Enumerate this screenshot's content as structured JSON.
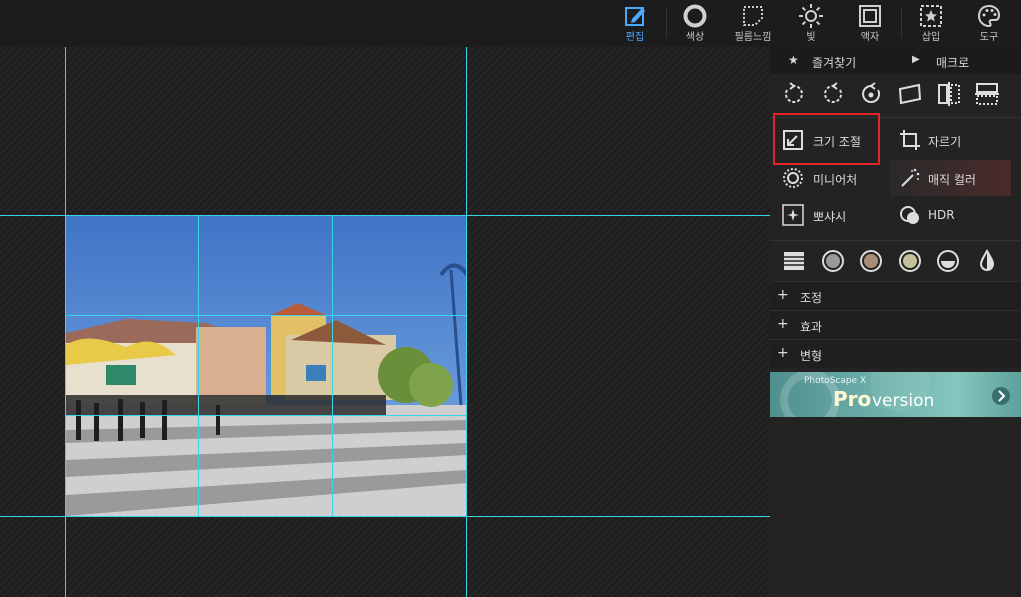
{
  "toolbar": {
    "tools": [
      {
        "label": "편집",
        "icon": "edit-icon",
        "active": true
      },
      {
        "label": "색상",
        "icon": "color-circle-icon"
      },
      {
        "label": "필름느낌",
        "icon": "film-icon"
      },
      {
        "label": "빛",
        "icon": "sun-icon"
      },
      {
        "label": "액자",
        "icon": "frame-icon"
      },
      {
        "label": "삽입",
        "icon": "insert-star-icon"
      },
      {
        "label": "도구",
        "icon": "palette-icon"
      }
    ],
    "active_color": "#4aa8ff"
  },
  "panel": {
    "favorites_label": "즐겨찾기",
    "macro_label": "매크로",
    "resize_label": "크기 조절",
    "crop_label": "자르기",
    "miniature_label": "미니어처",
    "magic_color_label": "매직 컬러",
    "bokeh_label": "뽀샤시",
    "hdr_label": "HDR",
    "sections": [
      "조정",
      "효과",
      "변형"
    ],
    "pro_banner": {
      "brand": "PhotoScape X",
      "pro": "Pro",
      "version": "version"
    },
    "highlight_color": "#e0262a"
  },
  "colors": {
    "guide": "#39d5e6"
  }
}
